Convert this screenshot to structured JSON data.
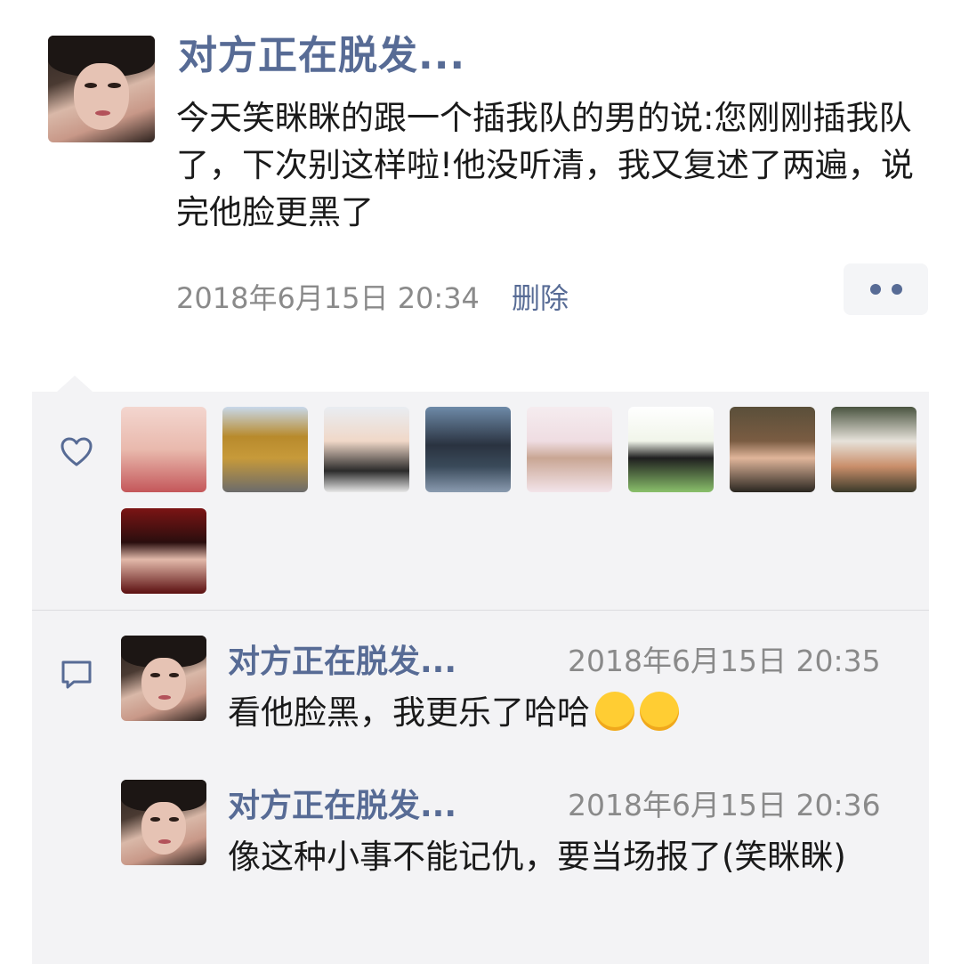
{
  "post": {
    "author": "对方正在脱发...",
    "text": "今天笑眯眯的跟一个插我队的男的说:您刚刚插我队了，下次别这样啦!他没听清，我又复述了两遍，说完他脸更黑了",
    "time": "2018年6月15日 20:34",
    "delete_label": "删除"
  },
  "likes": {
    "count": 9
  },
  "comments": [
    {
      "author": "对方正在脱发...",
      "time": "2018年6月15日 20:35",
      "text": "看他脸黑，我更乐了哈哈",
      "emojis": [
        "grinning-emoji",
        "thinking-emoji"
      ]
    },
    {
      "author": "对方正在脱发...",
      "time": "2018年6月15日 20:36",
      "text": "像这种小事不能记仇，要当场报了(笑眯眯)"
    }
  ],
  "colors": {
    "link": "#576b95",
    "meta": "#8a8a8a",
    "panel": "#f3f3f5"
  }
}
